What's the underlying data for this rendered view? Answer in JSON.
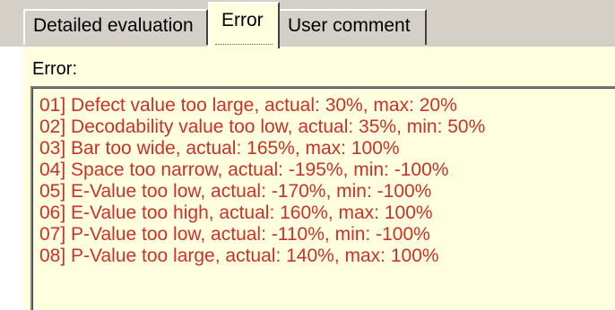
{
  "tabs": [
    {
      "label": "Detailed evaluation",
      "selected": false
    },
    {
      "label": "Error",
      "selected": true
    },
    {
      "label": "User comment",
      "selected": false
    }
  ],
  "panel": {
    "label": "Error:",
    "errors": [
      "01] Defect value too large, actual: 30%, max: 20%",
      "02] Decodability value too low, actual: 35%, min: 50%",
      "03] Bar too wide, actual: 165%, max: 100%",
      "04] Space too narrow, actual: -195%, min: -100%",
      "05] E-Value too low, actual: -170%, min: -100%",
      "06] E-Value too high, actual: 160%, max: 100%",
      "07] P-Value too low, actual: -110%, min: -100%",
      "08] P-Value too large, actual: 140%, max: 100%"
    ]
  },
  "colors": {
    "panel_background": "#ffffdf",
    "error_text": "#c8322a",
    "chrome_gray": "#d4d0c8"
  }
}
